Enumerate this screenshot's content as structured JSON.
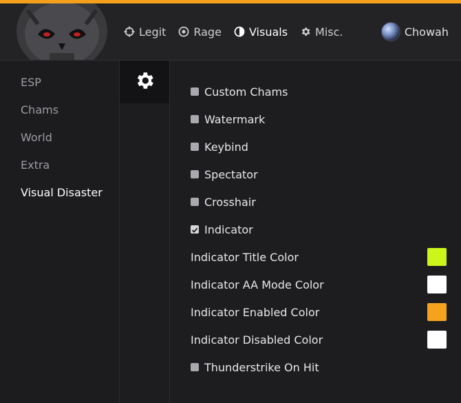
{
  "colors": {
    "accent": "#f5a01d",
    "background": "#1b1b1e",
    "header": "#232326"
  },
  "header": {
    "nav": [
      {
        "label": "Legit",
        "icon": "crosshair-icon",
        "active": false
      },
      {
        "label": "Rage",
        "icon": "target-icon",
        "active": false
      },
      {
        "label": "Visuals",
        "icon": "half-circle-icon",
        "active": true
      },
      {
        "label": "Misc.",
        "icon": "gear-icon",
        "active": false
      }
    ],
    "user": {
      "name": "Chowah",
      "icon": "avatar"
    }
  },
  "sidebar": {
    "items": [
      {
        "label": "ESP",
        "active": false
      },
      {
        "label": "Chams",
        "active": false
      },
      {
        "label": "World",
        "active": false
      },
      {
        "label": "Extra",
        "active": false
      },
      {
        "label": "Visual Disaster",
        "active": true
      }
    ]
  },
  "subnav": {
    "icon": "gear-icon"
  },
  "content": {
    "checkboxes": [
      {
        "label": "Custom Chams",
        "checked": false
      },
      {
        "label": "Watermark",
        "checked": false
      },
      {
        "label": "Keybind",
        "checked": false
      },
      {
        "label": "Spectator",
        "checked": false
      },
      {
        "label": "Crosshair",
        "checked": false
      },
      {
        "label": "Indicator",
        "checked": true
      }
    ],
    "color_options": [
      {
        "label": "Indicator Title Color",
        "color": "#ccf51a"
      },
      {
        "label": "Indicator AA Mode Color",
        "color": "#ffffff"
      },
      {
        "label": "Indicator Enabled Color",
        "color": "#f5a21d"
      },
      {
        "label": "Indicator Disabled Color",
        "color": "#ffffff"
      }
    ],
    "extra_checkbox": {
      "label": "Thunderstrike On Hit",
      "checked": false
    }
  }
}
